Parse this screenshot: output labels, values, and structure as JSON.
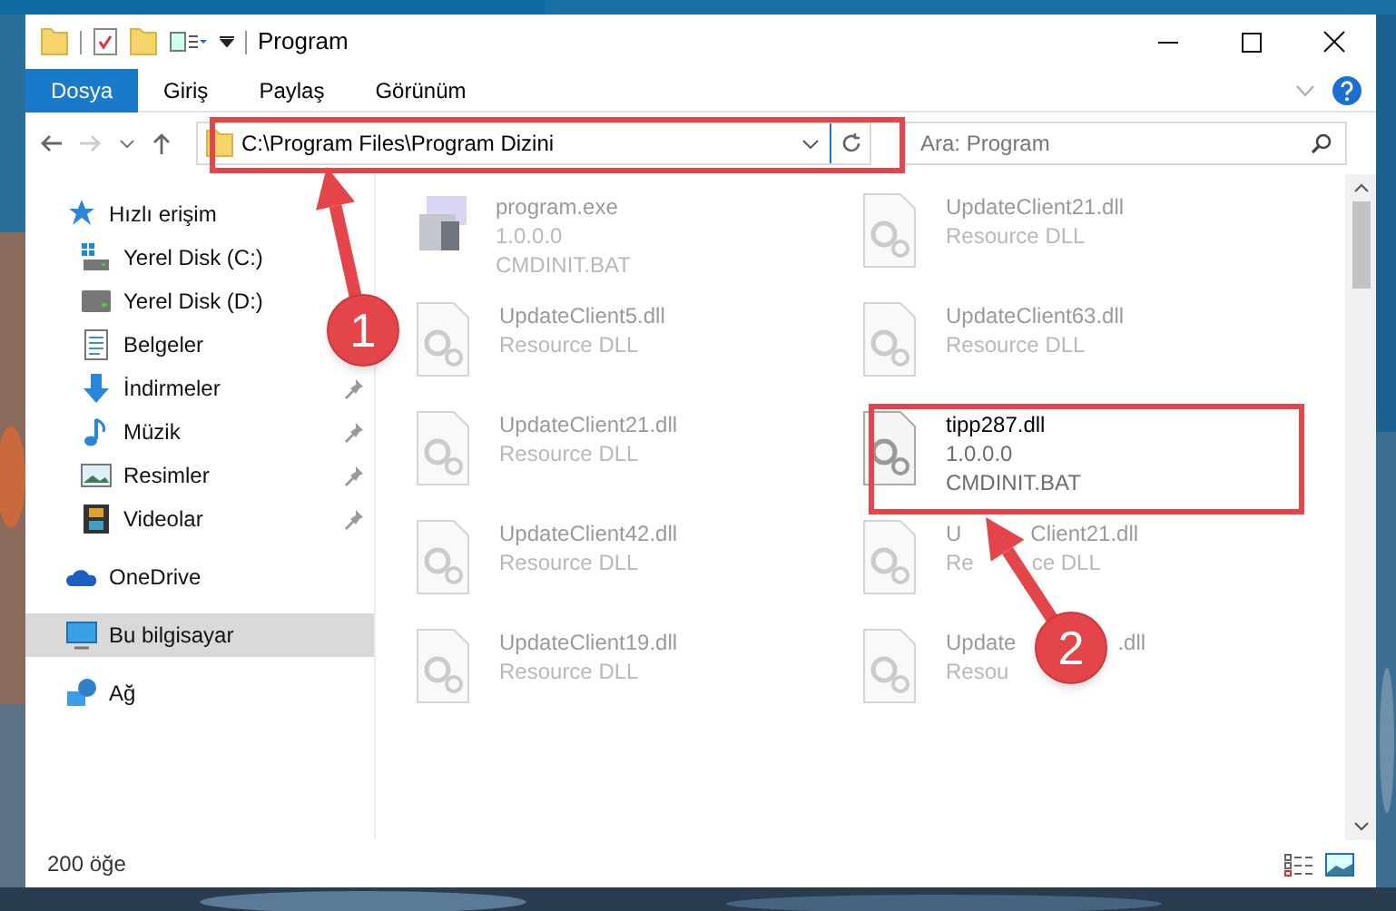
{
  "window": {
    "title": "Program"
  },
  "ribbon_tabs": [
    {
      "label": "Dosya",
      "selected": true
    },
    {
      "label": "Giriş",
      "selected": false
    },
    {
      "label": "Paylaş",
      "selected": false
    },
    {
      "label": "Görünüm",
      "selected": false
    }
  ],
  "address_bar": {
    "path": "C:\\Program Files\\Program Dizini"
  },
  "search": {
    "placeholder": "Ara: Program"
  },
  "sidebar": {
    "items": [
      {
        "label": "Hızlı erişim",
        "kind": "star",
        "selected": false,
        "children": [
          {
            "label": "Yerel Disk (C:)",
            "kind": "drive-c",
            "pinned": false,
            "selected": false
          },
          {
            "label": "Yerel Disk (D:)",
            "kind": "drive",
            "pinned": false,
            "selected": false
          },
          {
            "label": "Belgeler",
            "kind": "document",
            "pinned": false,
            "selected": false
          },
          {
            "label": "İndirmeler",
            "kind": "download",
            "pinned": true,
            "selected": false
          },
          {
            "label": "Müzik",
            "kind": "music",
            "pinned": true,
            "selected": false
          },
          {
            "label": "Resimler",
            "kind": "pictures",
            "pinned": true,
            "selected": false
          },
          {
            "label": "Videolar",
            "kind": "video",
            "pinned": true,
            "selected": false
          }
        ]
      },
      {
        "label": "OneDrive",
        "kind": "cloud",
        "selected": false
      },
      {
        "label": "Bu bilgisayar",
        "kind": "computer",
        "selected": true
      },
      {
        "label": "Ağ",
        "kind": "network",
        "selected": false
      }
    ]
  },
  "files": [
    {
      "kind": "exe",
      "name": [
        "program.exe"
      ],
      "details": [
        [
          "1.0.0.0"
        ],
        [
          "CMDINIT.BAT"
        ]
      ],
      "dimmed": true
    },
    {
      "kind": "dll",
      "name": [
        "UpdateClient21.dll"
      ],
      "details": [
        [
          "Resource DLL"
        ]
      ],
      "dimmed": true
    },
    {
      "kind": "dll",
      "name": [
        "UpdateClient5.dll"
      ],
      "details": [
        [
          "Resource DLL"
        ]
      ],
      "dimmed": true
    },
    {
      "kind": "dll",
      "name": [
        "UpdateClient63.dll"
      ],
      "details": [
        [
          "Resource DLL"
        ]
      ],
      "dimmed": true
    },
    {
      "kind": "dll",
      "name": [
        "UpdateClient21.dll"
      ],
      "details": [
        [
          "Resource DLL"
        ]
      ],
      "dimmed": true
    },
    {
      "kind": "dll",
      "name": [
        "tipp287.dll"
      ],
      "details": [
        [
          "1.0.0.0"
        ],
        [
          "CMDINIT.BAT"
        ]
      ],
      "dimmed": false
    },
    {
      "kind": "dll",
      "name": [
        "UpdateClient42.dll"
      ],
      "details": [
        [
          "Resource DLL"
        ]
      ],
      "dimmed": true
    },
    {
      "kind": "dll",
      "name": [
        "U",
        "Client21.dll"
      ],
      "details": [
        [
          "Re",
          "ce DLL"
        ]
      ],
      "dimmed": true
    },
    {
      "kind": "dll",
      "name": [
        "UpdateClient19.dll"
      ],
      "details": [
        [
          "Resource DLL"
        ]
      ],
      "dimmed": true
    },
    {
      "kind": "dll",
      "name": [
        "Update",
        ".dll"
      ],
      "details": [
        [
          "Resou"
        ]
      ],
      "dimmed": true
    }
  ],
  "status_bar": {
    "count": "200 öğe"
  },
  "annotations": [
    {
      "label": "1"
    },
    {
      "label": "2"
    }
  ]
}
